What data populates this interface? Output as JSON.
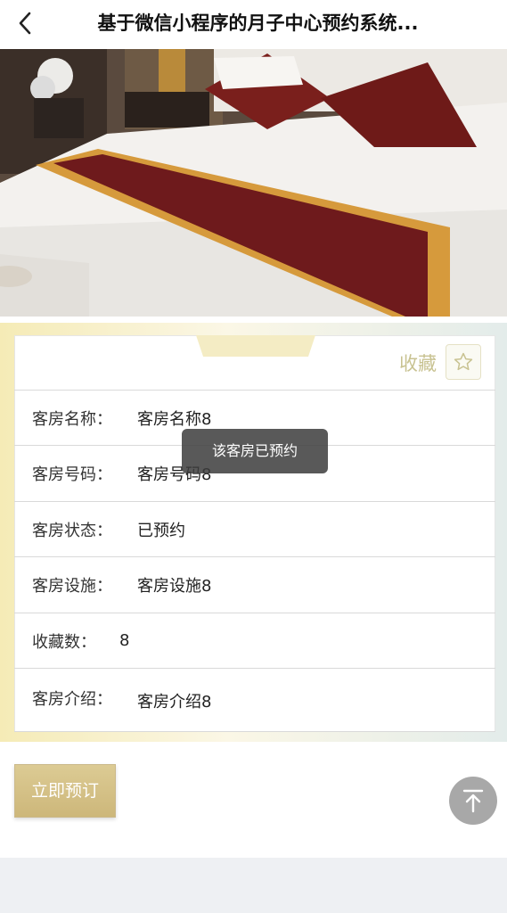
{
  "navbar": {
    "title": "基于微信小程序的月子中心预约系统..."
  },
  "photo": {
    "description_icon": "room-bed-photo"
  },
  "favorite": {
    "label": "收藏"
  },
  "details": [
    {
      "label": "客房名称：",
      "value": "客房名称8"
    },
    {
      "label": "客房号码：",
      "value": "客房号码8"
    },
    {
      "label": "客房状态：",
      "value": "已预约"
    },
    {
      "label": "客房设施：",
      "value": "客房设施8"
    },
    {
      "label": "收藏数：",
      "value": "8"
    },
    {
      "label": "客房介绍：",
      "value": "客房介绍8"
    }
  ],
  "toast": {
    "text": "该客房已预约"
  },
  "actions": {
    "book_label": "立即预订"
  },
  "colors": {
    "accent": "#cdb77a",
    "favorite_text": "#c8c291",
    "toast_bg": "#3c3c3c"
  }
}
